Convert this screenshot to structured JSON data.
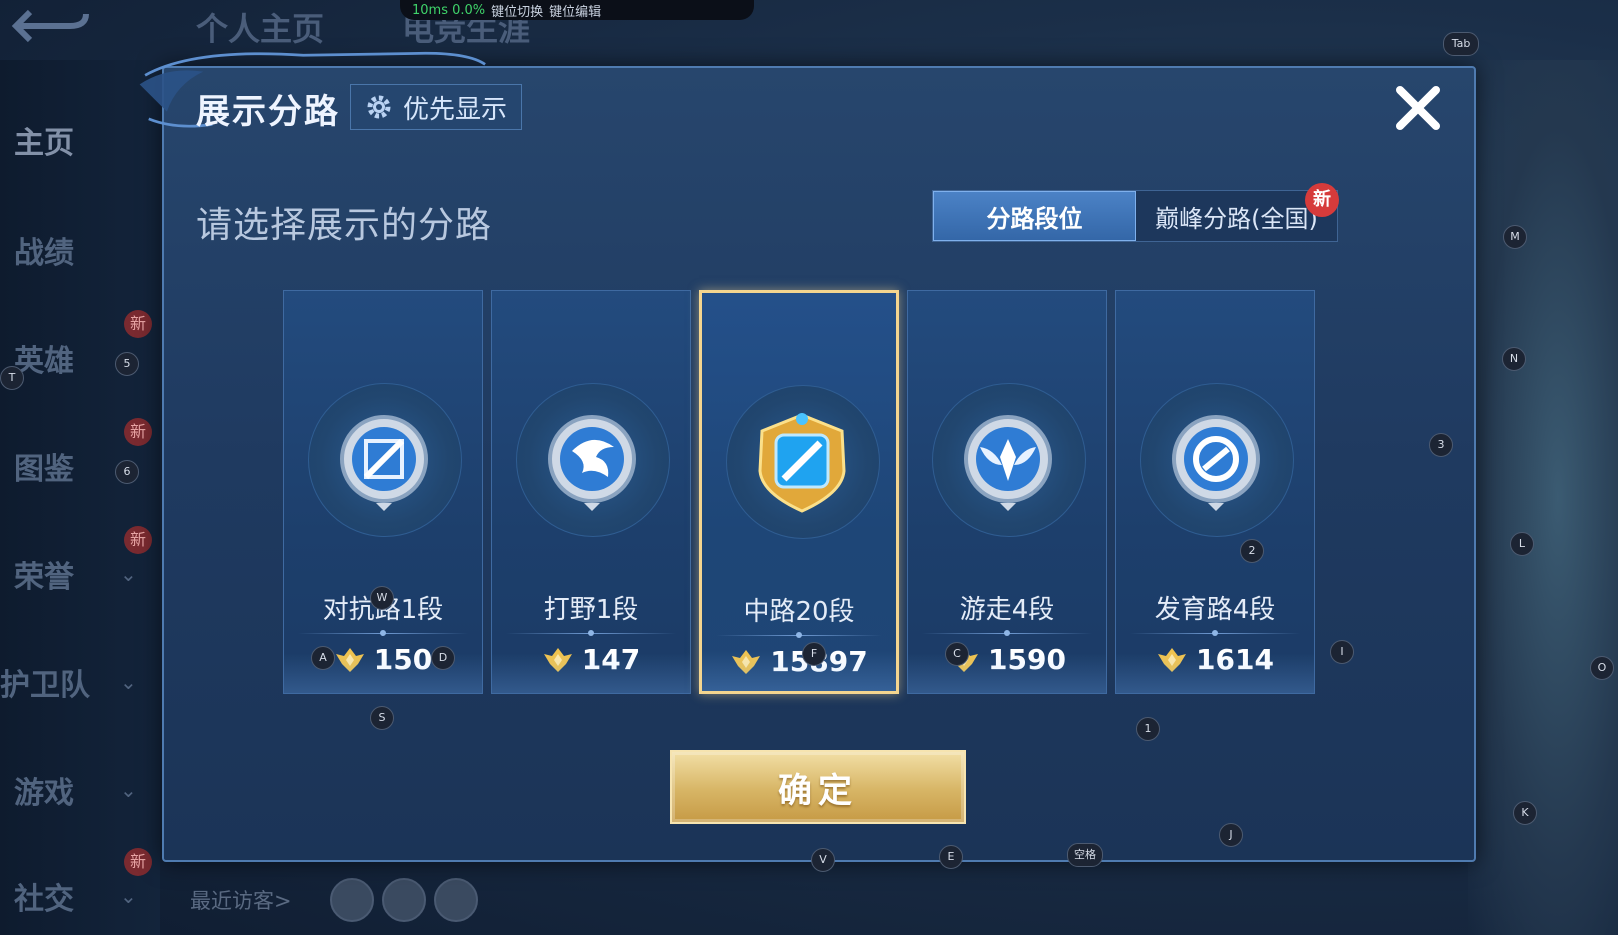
{
  "background": {
    "top_tabs": [
      "个人主页",
      "电竞生涯"
    ],
    "hud": {
      "perf_text": "10ms  0.0%",
      "key_switch": "键位切换",
      "key_edit": "键位编辑"
    },
    "sidebar": [
      {
        "label": "主页",
        "badge": ""
      },
      {
        "label": "战绩",
        "badge": ""
      },
      {
        "label": "英雄",
        "badge": "新"
      },
      {
        "label": "图鉴",
        "badge": "新"
      },
      {
        "label": "荣誉",
        "badge": "新"
      },
      {
        "label": "护卫队",
        "badge": ""
      },
      {
        "label": "游戏",
        "badge": ""
      },
      {
        "label": "社交",
        "badge": "新"
      }
    ],
    "recent_visitors": "最近访客>"
  },
  "dialog": {
    "title": "展示分路",
    "priority_label": "优先显示",
    "prompt": "请选择展示的分路",
    "tabs": [
      {
        "label": "分路段位",
        "active": true
      },
      {
        "label": "巅峰分路(全国)",
        "active": false,
        "badge": "新"
      }
    ],
    "lanes": [
      {
        "name": "对抗路1段",
        "score": "150",
        "selected": false,
        "emblem": "sword-shield-icon",
        "emblem_color": "#7fa8d8"
      },
      {
        "name": "打野1段",
        "score": "147",
        "selected": false,
        "emblem": "dragon-icon",
        "emblem_color": "#7fa8d8"
      },
      {
        "name": "中路20段",
        "score": "15897",
        "selected": true,
        "emblem": "staff-icon",
        "emblem_color": "#f2b84b"
      },
      {
        "name": "游走4段",
        "score": "1590",
        "selected": false,
        "emblem": "wings-icon",
        "emblem_color": "#7fa8d8"
      },
      {
        "name": "发育路4段",
        "score": "1614",
        "selected": false,
        "emblem": "bow-icon",
        "emblem_color": "#7fa8d8"
      }
    ],
    "confirm_label": "确定"
  },
  "key_hints": [
    "Tab",
    "M",
    "N",
    "3",
    "L",
    "I",
    "O",
    "K",
    "1",
    "2",
    "J",
    "A",
    "D",
    "W",
    "C",
    "F",
    "S",
    "V",
    "E",
    "空格",
    "T",
    "5",
    "6"
  ],
  "colors": {
    "accent": "#4b82c6",
    "selected_border": "#f4d58f",
    "confirm_gold": "#d7b565"
  }
}
